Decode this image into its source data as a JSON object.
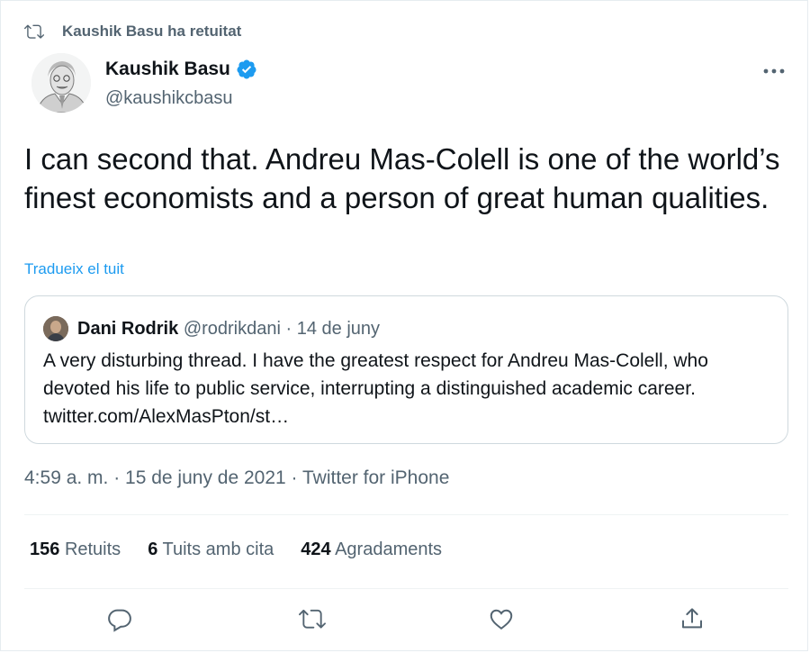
{
  "retweet_context": {
    "icon": "retweet-icon",
    "text": "Kaushik Basu ha retuitat"
  },
  "author": {
    "name": "Kaushik Basu",
    "handle": "@kaushikcbasu",
    "verified": true
  },
  "tweet": {
    "text": "I can second that. Andreu Mas-Colell is one of the world’s finest economists and a person of great human qualities.",
    "translate_label": "Tradueix el tuit"
  },
  "quoted_tweet": {
    "name": "Dani Rodrik",
    "handle": "@rodrikdani",
    "separator": " · ",
    "date": "14 de juny",
    "text": "A very disturbing thread. I have the greatest respect for Andreu Mas-Colell, who devoted his life to public service, interrupting a distinguished academic career. twitter.com/AlexMasPton/st…"
  },
  "timestamp": "4:59 a. m. · 15 de juny de 2021 · Twitter for iPhone",
  "stats": [
    {
      "count": "156",
      "label": "Retuits"
    },
    {
      "count": "6",
      "label": "Tuits amb cita"
    },
    {
      "count": "424",
      "label": "Agradaments"
    }
  ],
  "colors": {
    "accent": "#1d9bf0",
    "secondary_text": "#536471",
    "border": "#cfd9de"
  }
}
